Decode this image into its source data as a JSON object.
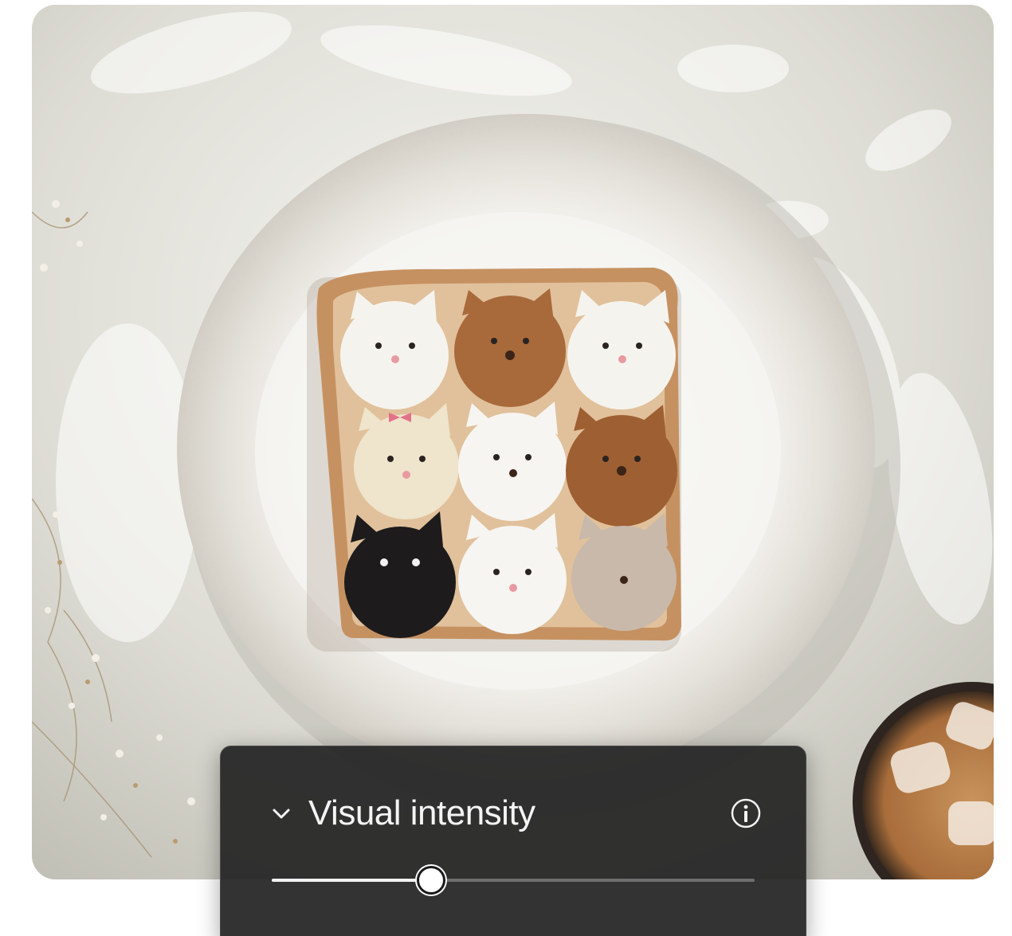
{
  "photo": {
    "subject_icon": "cat-toast-photo"
  },
  "panel": {
    "title": "Visual intensity",
    "collapse_icon": "chevron-down-icon",
    "info_icon": "info-icon",
    "slider": {
      "value": 0.33,
      "min": 0,
      "max": 1
    }
  },
  "colors": {
    "panel_bg": "#242424",
    "text": "#f4f4f4",
    "track": "#6e6e6e",
    "fill": "#f2f2f2"
  }
}
